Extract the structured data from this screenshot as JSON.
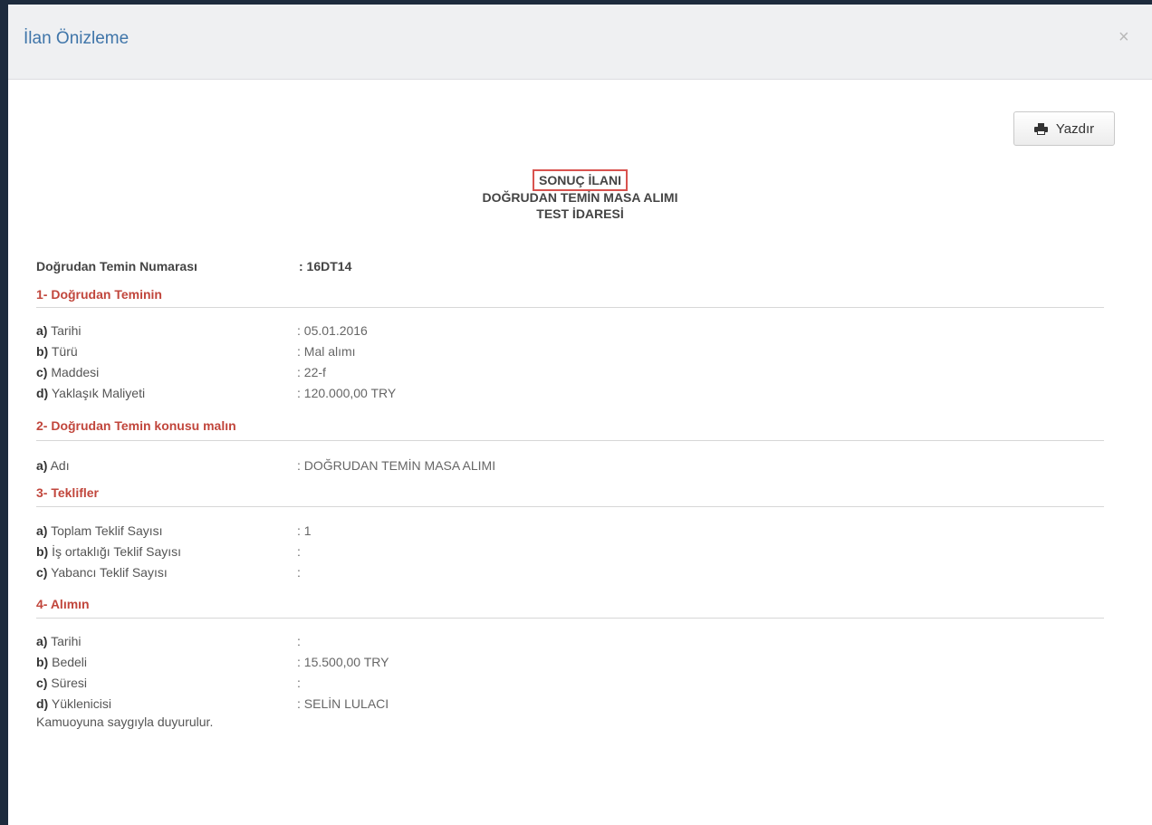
{
  "modal": {
    "title": "İlan Önizleme",
    "close_label": "×",
    "print_label": "Yazdır"
  },
  "document": {
    "type": "SONUÇ İLANI",
    "subject": "DOĞRUDAN TEMİN MASA ALIMI",
    "authority": "TEST İDARESİ",
    "number_label": "Doğrudan Temin Numarası",
    "number_value": ": 16DT14",
    "sections": [
      {
        "title": "1- Doğrudan Teminin",
        "rows": [
          {
            "key": "a)",
            "label": " Tarihi",
            "value": ": 05.01.2016"
          },
          {
            "key": "b)",
            "label": " Türü",
            "value": ": Mal alımı"
          },
          {
            "key": "c)",
            "label": " Maddesi",
            "value": ": 22-f"
          },
          {
            "key": "d)",
            "label": " Yaklaşık Maliyeti",
            "value": ": 120.000,00 TRY"
          }
        ]
      },
      {
        "title": "2- Doğrudan Temin konusu malın",
        "rows": [
          {
            "key": "a)",
            "label": " Adı",
            "value": ": DOĞRUDAN TEMİN MASA ALIMI"
          }
        ]
      },
      {
        "title": "3- Teklifler",
        "rows": [
          {
            "key": "a)",
            "label": " Toplam Teklif Sayısı",
            "value": ": 1"
          },
          {
            "key": "b)",
            "label": " İş ortaklığı Teklif Sayısı",
            "value": ":"
          },
          {
            "key": "c)",
            "label": " Yabancı Teklif Sayısı",
            "value": ":"
          }
        ]
      },
      {
        "title": "4- Alımın",
        "rows": [
          {
            "key": "a)",
            "label": " Tarihi",
            "value": ":"
          },
          {
            "key": "b)",
            "label": " Bedeli",
            "value": ": 15.500,00 TRY"
          },
          {
            "key": "c)",
            "label": " Süresi",
            "value": ":"
          },
          {
            "key": "d)",
            "label": " Yüklenicisi",
            "value": ": SELİN LULACI"
          }
        ]
      }
    ],
    "closing": "Kamuoyuna saygıyla duyurulur."
  }
}
